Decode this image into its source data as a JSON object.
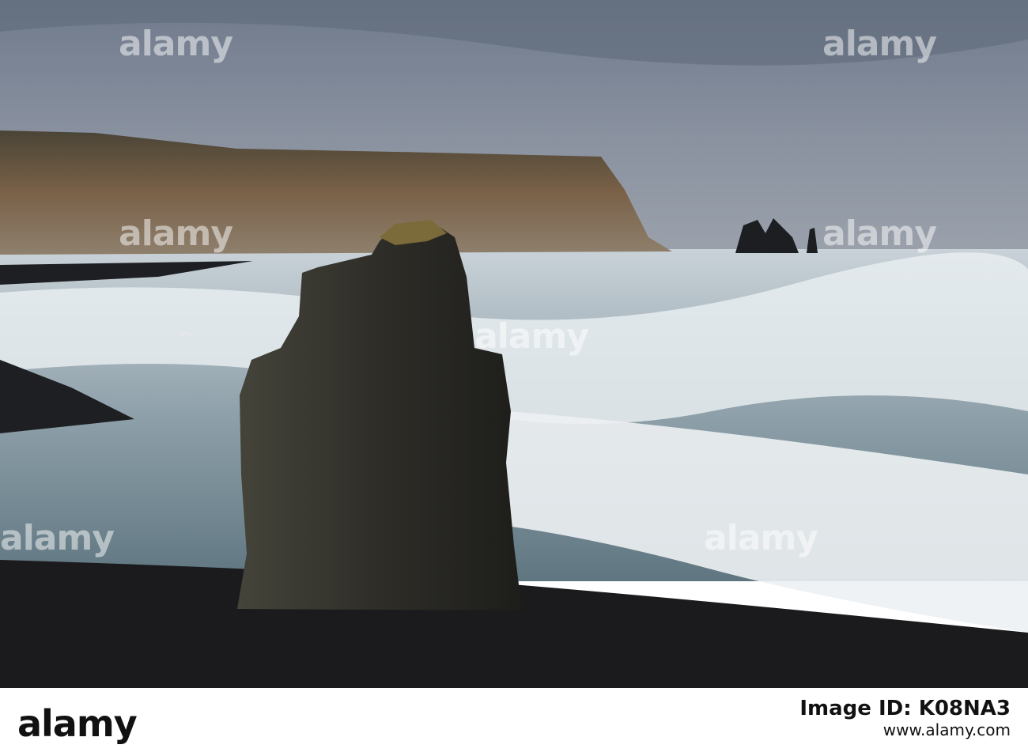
{
  "photo": {
    "description": "Black sand beach with basalt sea stack, surf and distant cliffs under an overcast sky",
    "colors": {
      "sky": "#7d8595",
      "sea": "#5e7580",
      "foam": "#eef2f4",
      "sand": "#1b1b1d",
      "rock": "#2e2d28",
      "cliff": "#6d5a44"
    }
  },
  "watermarks": [
    "alamy",
    "alamy",
    "alamy",
    "alamy",
    "alamy",
    "alamy",
    "alamy"
  ],
  "footer": {
    "brand": "alamy",
    "image_id_label": "Image ID: K08NA3",
    "site": "www.alamy.com"
  }
}
